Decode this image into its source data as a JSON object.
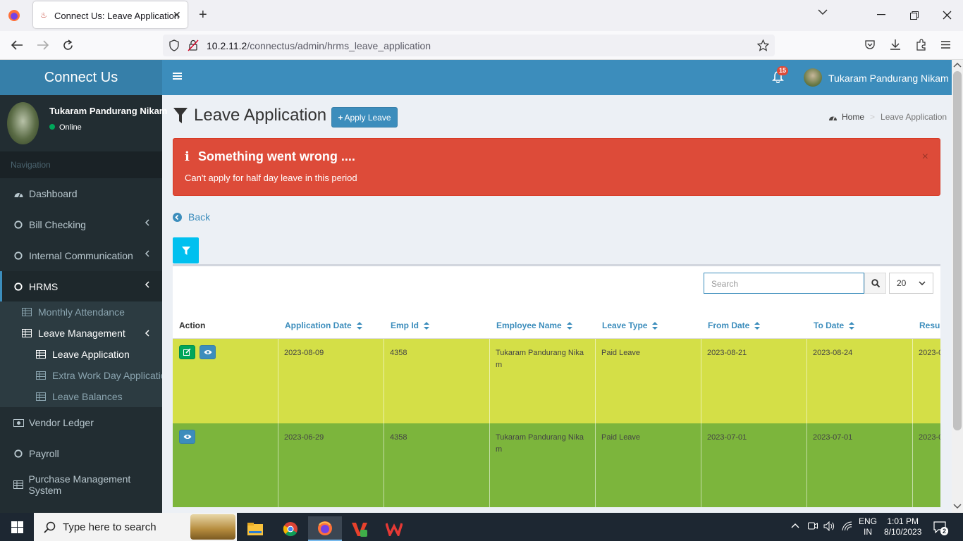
{
  "browser": {
    "tab_title": "Connect Us: Leave Application",
    "url_host": "10.2.11.2",
    "url_path": "/connectus/admin/hrms_leave_application"
  },
  "header": {
    "brand": "Connect Us",
    "notification_count": "15",
    "user_name": "Tukaram Pandurang Nikam"
  },
  "sidebar": {
    "user_name": "Tukaram Pandurang Nikam",
    "status": "Online",
    "nav_header": "Navigation",
    "items": [
      {
        "label": "Dashboard",
        "icon": "dashboard-icon"
      },
      {
        "label": "Bill Checking",
        "icon": "circle-icon"
      },
      {
        "label": "Internal Communication",
        "icon": "circle-icon"
      },
      {
        "label": "HRMS",
        "icon": "circle-icon"
      },
      {
        "label": "Vendor Ledger",
        "icon": "money-icon"
      },
      {
        "label": "Payroll",
        "icon": "circle-icon"
      },
      {
        "label": "Purchase Management System",
        "icon": "table-icon"
      }
    ],
    "hrms_sub": [
      {
        "label": "Monthly Attendance"
      },
      {
        "label": "Leave Management"
      }
    ],
    "leave_sub": [
      {
        "label": "Leave Application"
      },
      {
        "label": "Extra Work Day Application"
      },
      {
        "label": "Leave Balances"
      }
    ]
  },
  "page": {
    "title": "Leave Application",
    "apply_button": "Apply Leave",
    "breadcrumb_home": "Home",
    "breadcrumb_current": "Leave Application",
    "alert_title": "Something went wrong ....",
    "alert_message": "Can't apply for half day leave in this period",
    "back_label": "Back",
    "search_placeholder": "Search",
    "page_size": "20"
  },
  "table": {
    "columns": [
      "Action",
      "Application Date",
      "Emp Id",
      "Employee Name",
      "Leave Type",
      "From Date",
      "To Date",
      "Resur"
    ],
    "rows": [
      {
        "application_date": "2023-08-09",
        "emp_id": "4358",
        "employee_name": "Tukaram Pandurang Nikam",
        "leave_type": "Paid Leave",
        "from_date": "2023-08-21",
        "to_date": "2023-08-24",
        "resume": "2023-0",
        "color": "#d4df47"
      },
      {
        "application_date": "2023-06-29",
        "emp_id": "4358",
        "employee_name": "Tukaram Pandurang Nikam",
        "leave_type": "Paid Leave",
        "from_date": "2023-07-01",
        "to_date": "2023-07-01",
        "resume": "2023-0",
        "color": "#7cb53c"
      }
    ]
  },
  "taskbar": {
    "search_placeholder": "Type here to search",
    "lang": "ENG",
    "region": "IN",
    "time": "1:01 PM",
    "date": "8/10/2023",
    "notif_count": "2"
  }
}
